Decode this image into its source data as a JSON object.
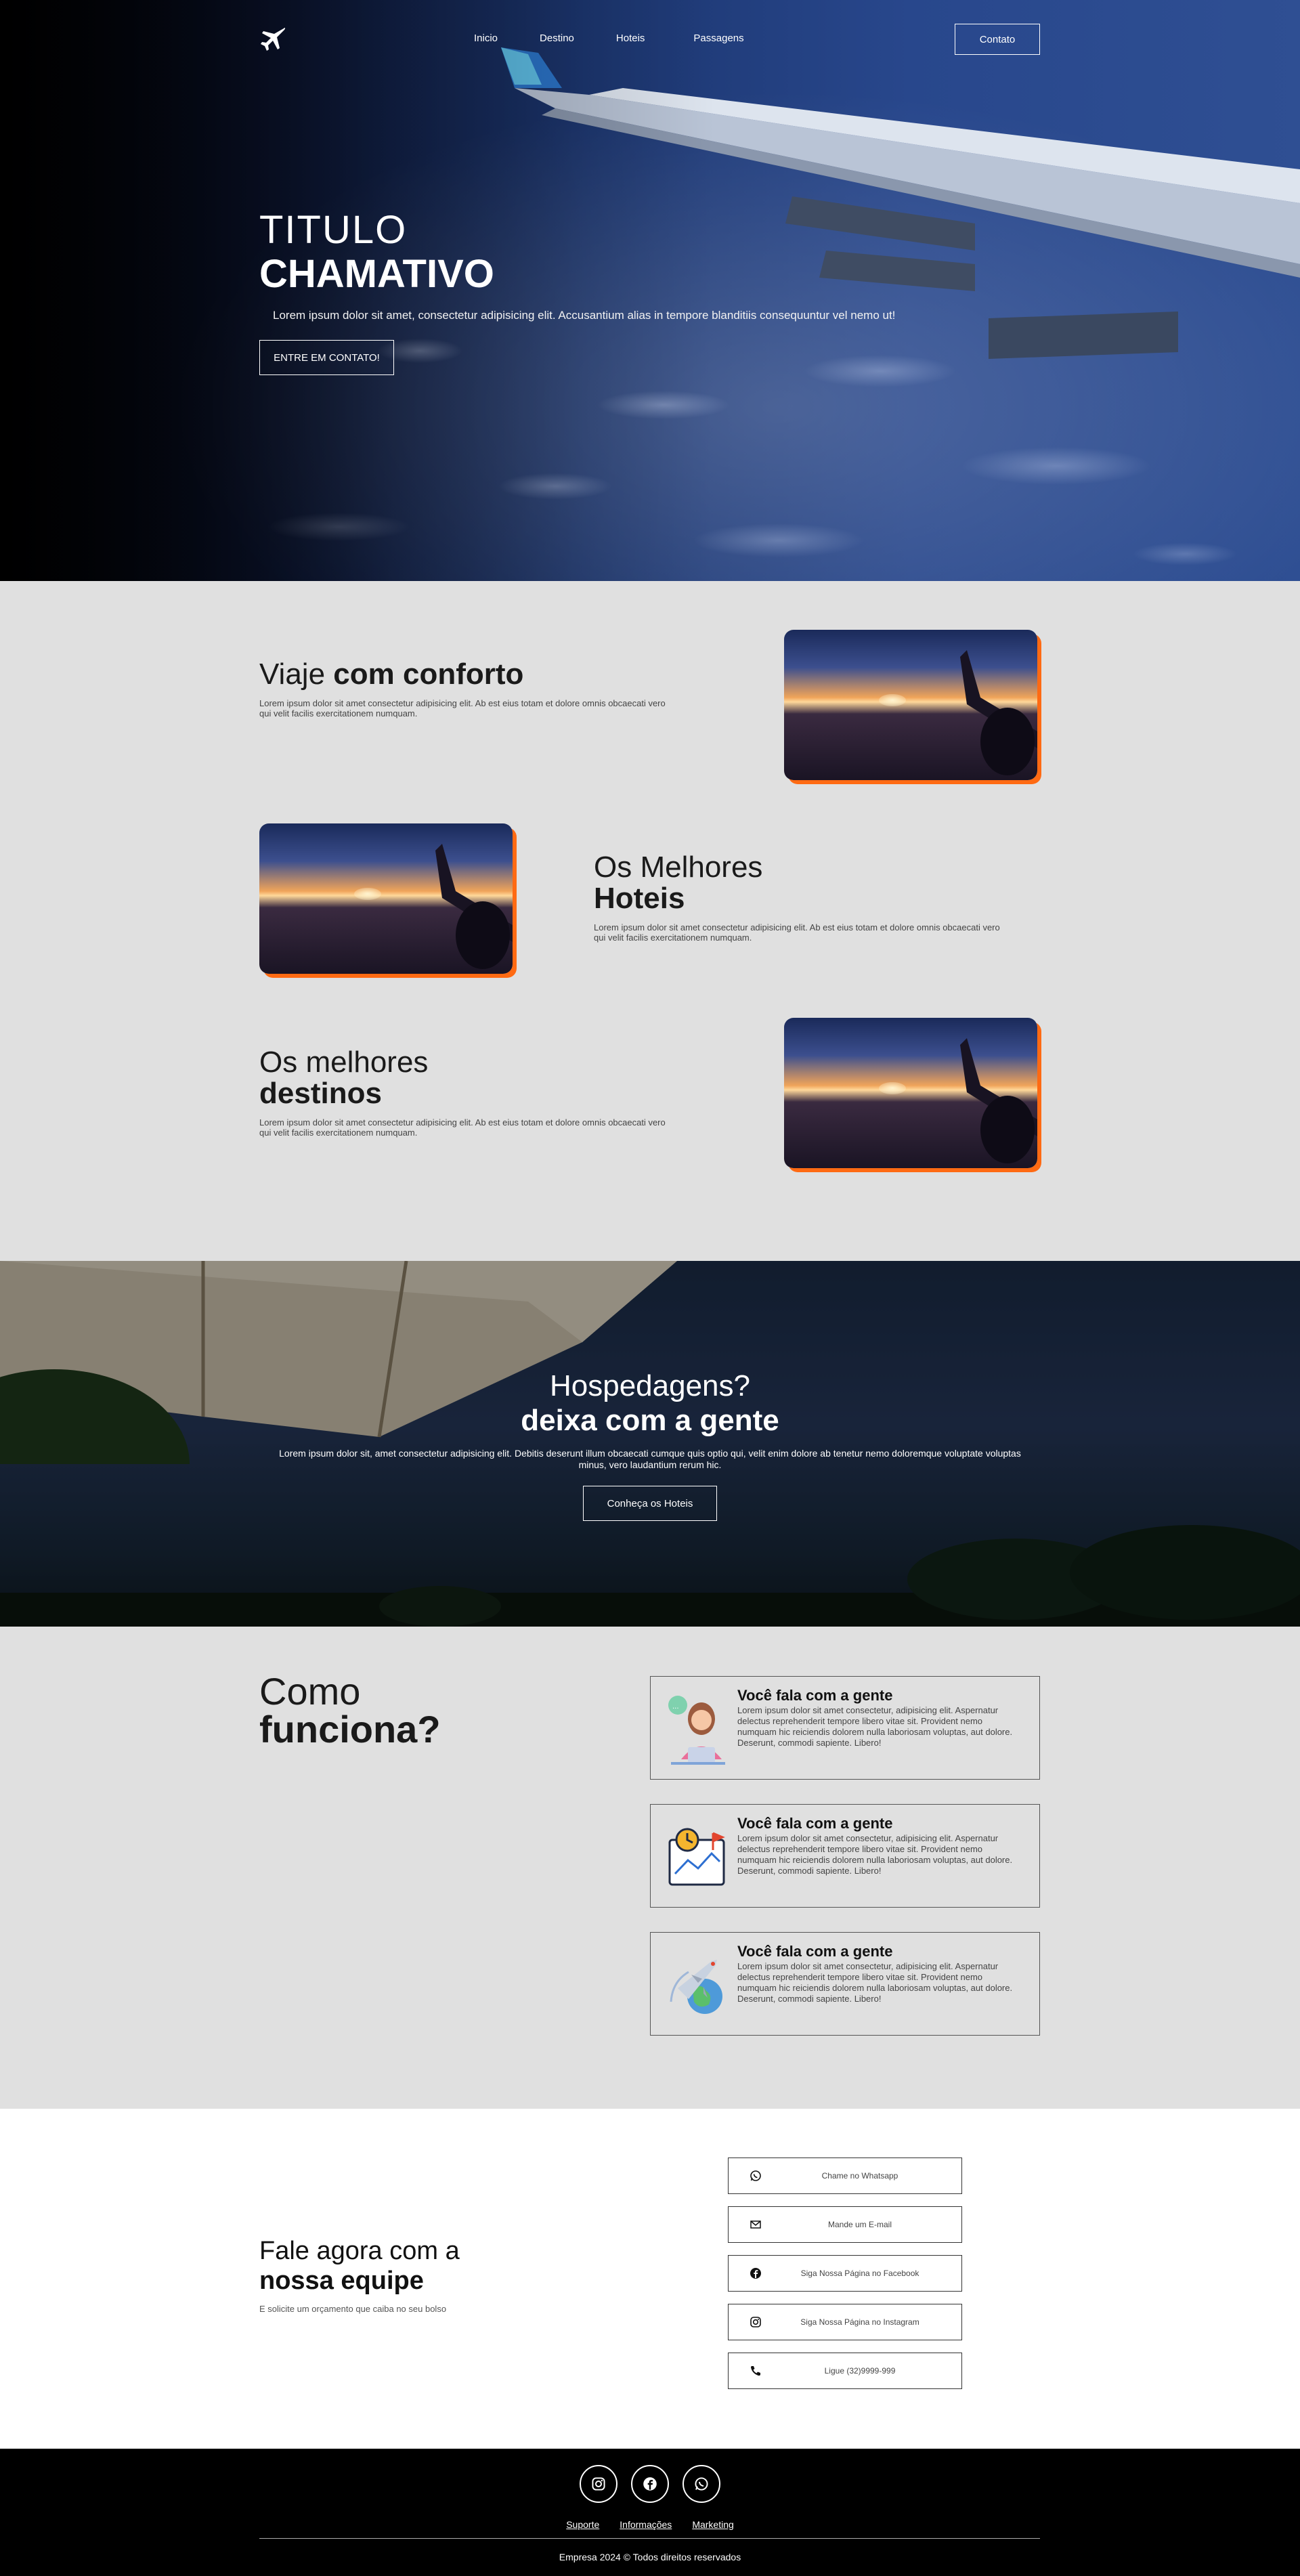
{
  "nav": {
    "links": [
      "Inicio",
      "Destino",
      "Hoteis",
      "Passagens"
    ],
    "contact_label": "Contato"
  },
  "hero": {
    "title_light": "TITULO",
    "title_bold": "CHAMATIVO",
    "lead": "Lorem ipsum dolor sit amet, consectetur adipisicing elit. Accusantium alias in tempore blanditiis consequuntur vel nemo ut!",
    "button": "ENTRE EM CONTATO!"
  },
  "features": [
    {
      "light": "Viaje ",
      "bold": "com conforto",
      "text": "Lorem ipsum dolor sit amet consectetur adipisicing elit. Ab est eius totam et dolore omnis obcaecati vero qui velit facilis exercitationem numquam."
    },
    {
      "light": "Os Melhores ",
      "bold": "Hoteis",
      "text": "Lorem ipsum dolor sit amet consectetur adipisicing elit. Ab est eius totam et dolore omnis obcaecati vero qui velit facilis exercitationem numquam."
    },
    {
      "light": "Os melhores ",
      "bold": "destinos",
      "text": "Lorem ipsum dolor sit amet consectetur adipisicing elit. Ab est eius totam et dolore omnis obcaecati vero qui velit facilis exercitationem numquam."
    }
  ],
  "cta": {
    "light": "Hospedagens?",
    "bold": "deixa com a gente",
    "text": "Lorem ipsum dolor sit, amet consectetur adipisicing elit. Debitis deserunt illum obcaecati cumque quis optio qui, velit enim dolore ab tenetur nemo doloremque voluptate voluptas minus, vero laudantium rerum hic.",
    "button": "Conheça os Hoteis"
  },
  "how": {
    "light": "Como",
    "bold": "funciona?",
    "cards": [
      {
        "title": "Você fala com a gente",
        "text": "Lorem ipsum dolor sit amet consectetur, adipisicing elit. Aspernatur delectus reprehenderit tempore libero vitae sit. Provident nemo numquam hic reiciendis dolorem nulla laboriosam voluptas, aut dolore. Deserunt, commodi sapiente. Libero!",
        "icon": "support-agent-icon"
      },
      {
        "title": "Você fala com a gente",
        "text": "Lorem ipsum dolor sit amet consectetur, adipisicing elit. Aspernatur delectus reprehenderit tempore libero vitae sit. Provident nemo numquam hic reiciendis dolorem nulla laboriosam voluptas, aut dolore. Deserunt, commodi sapiente. Libero!",
        "icon": "map-clock-icon"
      },
      {
        "title": "Você fala com a gente",
        "text": "Lorem ipsum dolor sit amet consectetur, adipisicing elit. Aspernatur delectus reprehenderit tempore libero vitae sit. Provident nemo numquam hic reiciendis dolorem nulla laboriosam voluptas, aut dolore. Deserunt, commodi sapiente. Libero!",
        "icon": "plane-globe-icon"
      }
    ]
  },
  "contact": {
    "light": "Fale agora com a",
    "bold": "nossa equipe",
    "sub": "E solicite um orçamento que caiba no seu bolso",
    "buttons": [
      {
        "label": "Chame no Whatsapp",
        "icon": "whatsapp-icon"
      },
      {
        "label": "Mande um E-mail",
        "icon": "email-icon"
      },
      {
        "label": "Siga Nossa Página no Facebook",
        "icon": "facebook-icon"
      },
      {
        "label": "Siga Nossa Página no Instagram",
        "icon": "instagram-icon"
      },
      {
        "label": "Ligue (32)9999-999",
        "icon": "phone-icon"
      }
    ]
  },
  "footer": {
    "social_icons": [
      "instagram-icon",
      "facebook-icon",
      "whatsapp-icon"
    ],
    "links": [
      "Suporte",
      "Informações",
      "Marketing"
    ],
    "copyright": "Empresa 2024 © Todos direitos reservados"
  },
  "colors": {
    "accent": "#ff6a13",
    "section_bg": "#e0e0e0",
    "hero_blue": "#28478c"
  }
}
